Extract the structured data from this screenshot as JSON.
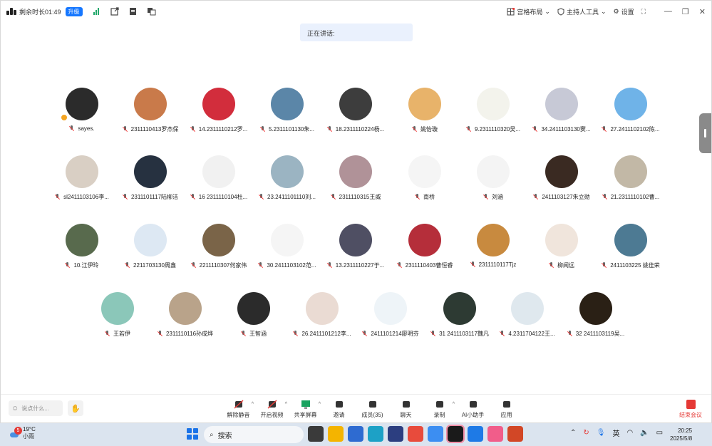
{
  "topbar": {
    "remaining": "剩余时长01:49",
    "upgrade": "升级",
    "layout": "宫格布局",
    "host_tools": "主持人工具",
    "settings": "设置"
  },
  "speaking": "正在讲话:",
  "participants": [
    {
      "name": "sayes.",
      "color": "#2b2b2b"
    },
    {
      "name": "2311110413罗杰保",
      "color": "#c97a4a"
    },
    {
      "name": "14.2311110212罗...",
      "color": "#d22d3c"
    },
    {
      "name": "5.2311101130朱...",
      "color": "#5b86a8"
    },
    {
      "name": "18.2311110224杨...",
      "color": "#3d3d3d"
    },
    {
      "name": "姚怡璇",
      "color": "#e8b36a"
    },
    {
      "name": "9.2311110320吴...",
      "color": "#f3f3ec"
    },
    {
      "name": "34.2411103130窦...",
      "color": "#c7c9d6"
    },
    {
      "name": "27.2411102102陈...",
      "color": "#6fb3e8"
    },
    {
      "name": "sl2411103106李...",
      "color": "#d9cfc4"
    },
    {
      "name": "2311101117陆柳洁",
      "color": "#263140"
    },
    {
      "name": "16 2311110104杜...",
      "color": "#f1f1f1"
    },
    {
      "name": "23.2411101110刘...",
      "color": "#9bb4c2"
    },
    {
      "name": "2311110315王威",
      "color": "#b09298"
    },
    {
      "name": "南桥",
      "color": "#f5f5f5"
    },
    {
      "name": "刘涵",
      "color": "#f4f4f4"
    },
    {
      "name": "2411103127朱立勋",
      "color": "#3a2a22"
    },
    {
      "name": "21.2311110102曹...",
      "color": "#c2b8a6"
    },
    {
      "name": "10.江伊玲",
      "color": "#586a4d"
    },
    {
      "name": "2211703130周鑫",
      "color": "#dde8f3"
    },
    {
      "name": "2211110307何家伟",
      "color": "#7a6448"
    },
    {
      "name": "30.2411103102范...",
      "color": "#f5f5f5"
    },
    {
      "name": "13.2311110227于...",
      "color": "#4f4f63"
    },
    {
      "name": "2311110403曹恒睿",
      "color": "#b52e3a"
    },
    {
      "name": "2311110117Tjz",
      "color": "#c88a3f"
    },
    {
      "name": "柳闻远",
      "color": "#f0e5dc"
    },
    {
      "name": "2411103225 姚佳荣",
      "color": "#4d7a93"
    },
    {
      "name": "王若伊",
      "color": "#8bc7b9"
    },
    {
      "name": "2311110116孙成烨",
      "color": "#b9a38a"
    },
    {
      "name": "王智涵",
      "color": "#2b2b2b"
    },
    {
      "name": "26.2411101212李...",
      "color": "#eadbd3"
    },
    {
      "name": "2411101214廖明芬",
      "color": "#eef4f8"
    },
    {
      "name": "31 2411103117魏凡",
      "color": "#2d3a33"
    },
    {
      "name": "4.2311704122王...",
      "color": "#dfe8ee"
    },
    {
      "name": "32 2411103119吴...",
      "color": "#2a2015"
    }
  ],
  "bottombar": {
    "say_placeholder": "说点什么...",
    "tools": [
      {
        "label": "解除静音",
        "icon": "mic-muted-icon"
      },
      {
        "label": "开启视频",
        "icon": "camera-off-icon"
      },
      {
        "label": "共享屏幕",
        "icon": "share-screen-icon"
      },
      {
        "label": "邀请",
        "icon": "invite-icon"
      },
      {
        "label": "成员(35)",
        "icon": "members-icon"
      },
      {
        "label": "聊天",
        "icon": "chat-icon"
      },
      {
        "label": "录制",
        "icon": "record-icon"
      },
      {
        "label": "AI小助手",
        "icon": "ai-assistant-icon"
      },
      {
        "label": "应用",
        "icon": "apps-icon"
      }
    ],
    "end": "结束会议"
  },
  "taskbar": {
    "weather_badge": "5",
    "temp": "19°C",
    "condition": "小雨",
    "search": "搜索",
    "lang": "英",
    "time": "20:25",
    "date": "2025/5/8"
  }
}
